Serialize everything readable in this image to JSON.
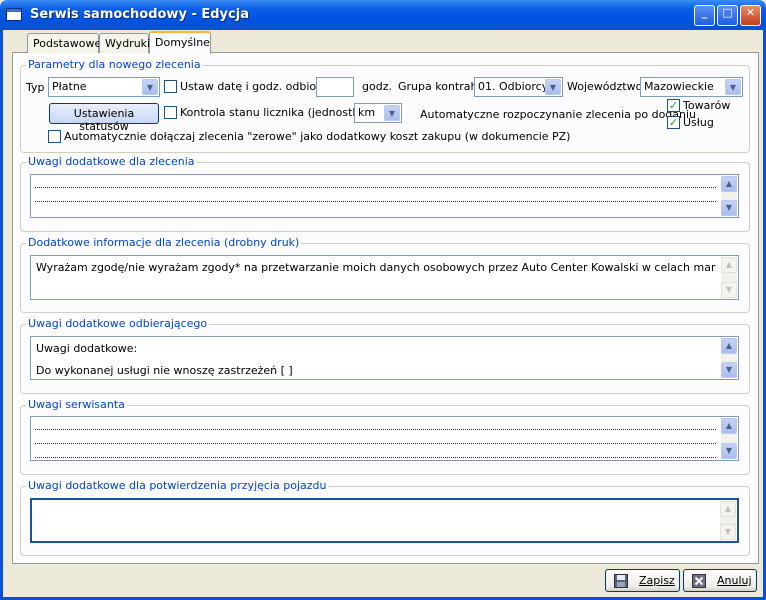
{
  "window": {
    "title": "Serwis samochodowy - Edycja",
    "minimize": "_",
    "maximize": "□",
    "close": "✕"
  },
  "tabs": [
    {
      "label": "Podstawowe"
    },
    {
      "label": "Wydruki"
    },
    {
      "label": "Domyślne"
    }
  ],
  "params": {
    "group_title": "Parametry dla nowego zlecenia",
    "typ_label": "Typ",
    "typ_value": "Płatne",
    "set_date_label": "Ustaw datę i godz. odbioru",
    "hours_value": "",
    "hours_unit": "godz.",
    "grupa_label": "Grupa kontrah.",
    "grupa_value": "01. Odbiorcy",
    "woj_label": "Województwo",
    "woj_value": "Mazowieckie",
    "status_btn": "Ustawienia statusów",
    "counter_label": "Kontrola stanu licznika (jednostka)",
    "counter_value": "km",
    "auto_start_label": "Automatyczne rozpoczynanie zlecenia po dodaniu",
    "towarow_label": "Towarów",
    "uslug_label": "Usług",
    "zero_label": "Automatycznie dołączaj zlecenia \"zerowe\" jako dodatkowy koszt zakupu (w dokumencie PZ)"
  },
  "memo1": {
    "title": "Uwagi dodatkowe dla zlecenia"
  },
  "memo2": {
    "title": "Dodatkowe informacje dla zlecenia (drobny druk)",
    "text": "Wyrażam zgodę/nie wyrażam zgody* na przetwarzanie moich danych osobowych przez Auto Center Kowalski w celach marketingowych zgodn"
  },
  "memo3": {
    "title": "Uwagi dodatkowe odbierającego",
    "line1": "Uwagi dodatkowe:",
    "line2": "Do wykonanej usługi nie wnoszę zastrzeżeń    [  ]"
  },
  "memo4": {
    "title": "Uwagi serwisanta"
  },
  "memo5": {
    "title": "Uwagi dodatkowe dla potwierdzenia przyjęcia pojazdu"
  },
  "footer": {
    "save": "Zapisz",
    "cancel": "Anuluj"
  },
  "icons": {
    "arrow_down": "▼",
    "arrow_up": "▲",
    "check": "✓"
  }
}
